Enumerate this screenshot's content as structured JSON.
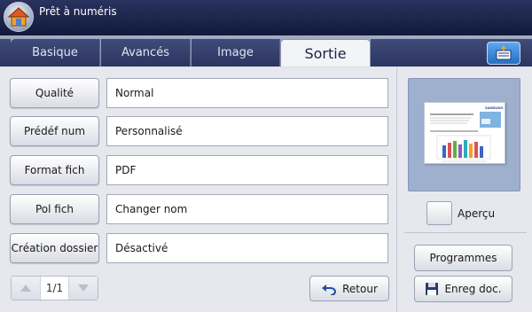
{
  "header": {
    "title": "Prêt à numéris",
    "home_icon": "home-icon"
  },
  "tabs": [
    {
      "label": "Basique",
      "active": false
    },
    {
      "label": "Avancés",
      "active": false
    },
    {
      "label": "Image",
      "active": false
    },
    {
      "label": "Sortie",
      "active": true
    }
  ],
  "job_status_icon": "job-status-icon",
  "settings": [
    {
      "label": "Qualité",
      "value": "Normal"
    },
    {
      "label": "Prédéf num",
      "value": "Personnalisé"
    },
    {
      "label": "Format fich",
      "value": "PDF"
    },
    {
      "label": "Pol fich",
      "value": "Changer nom"
    },
    {
      "label": "Création dossier",
      "value": "Désactivé"
    }
  ],
  "pager": {
    "label": "1/1"
  },
  "back_button": {
    "label": "Retour"
  },
  "preview": {
    "checkbox_label": "Aperçu",
    "checked": false
  },
  "side_buttons": {
    "programs": "Programmes",
    "save_doc": "Enreg doc."
  },
  "colors": {
    "header": "#1b2448",
    "tab_active": "#f2f4f8",
    "tab_inactive": "#334070",
    "preview_bg": "#9fb0cf"
  }
}
